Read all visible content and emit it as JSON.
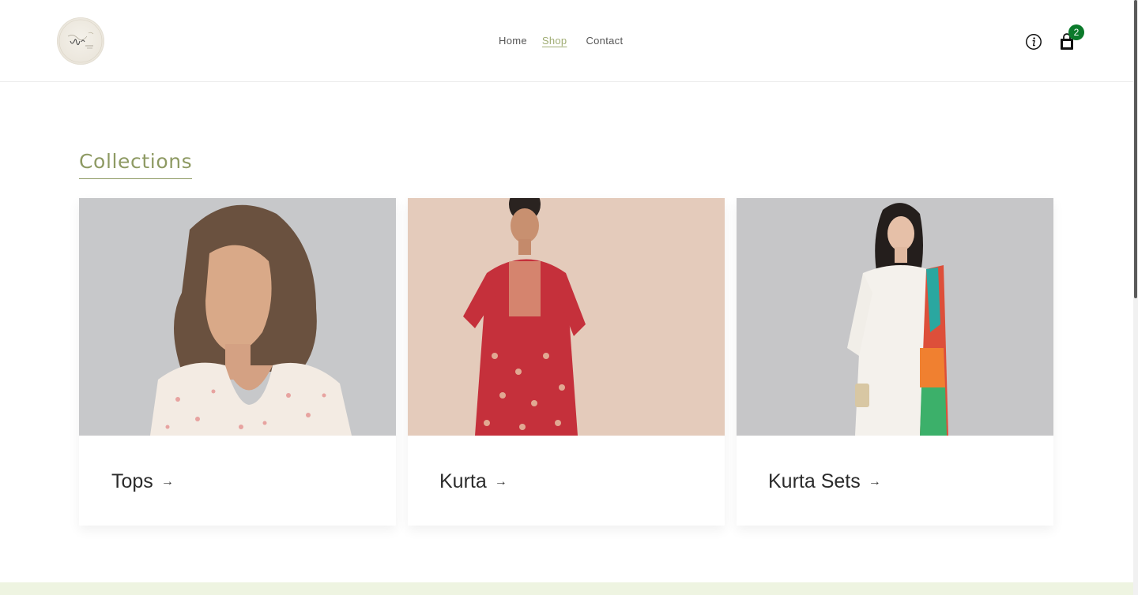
{
  "header": {
    "nav": [
      {
        "label": "Home"
      },
      {
        "label": "Shop"
      },
      {
        "label": "Contact"
      }
    ],
    "cart_count": "2",
    "icons": {
      "info": "info-icon",
      "cart": "shopping-bag-icon"
    }
  },
  "collections": {
    "title": "Collections",
    "items": [
      {
        "label": "Tops",
        "arrow": "→"
      },
      {
        "label": "Kurta",
        "arrow": "→"
      },
      {
        "label": "Kurta Sets",
        "arrow": "→"
      }
    ]
  },
  "colors": {
    "accent": "#8e9a63",
    "nav_active": "#a0ad74",
    "badge": "#0b7a2b",
    "footer": "#eef4e1"
  }
}
